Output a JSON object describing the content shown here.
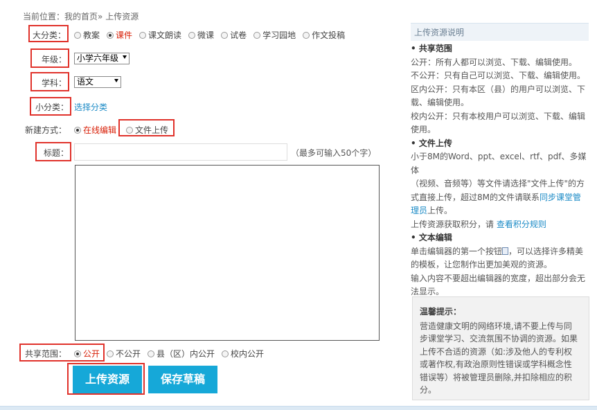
{
  "breadcrumb": {
    "prefix": "当前位置：",
    "home": "我的首页",
    "sep": "»",
    "current": "上传资源"
  },
  "category": {
    "label": "大分类：",
    "options": [
      {
        "label": "教案",
        "selected": false
      },
      {
        "label": "课件",
        "selected": true
      },
      {
        "label": "课文朗读",
        "selected": false
      },
      {
        "label": "微课",
        "selected": false
      },
      {
        "label": "试卷",
        "selected": false
      },
      {
        "label": "学习园地",
        "selected": false
      },
      {
        "label": "作文投稿",
        "selected": false
      }
    ]
  },
  "grade": {
    "label": "年级：",
    "value": "小学六年级"
  },
  "subject": {
    "label": "学科：",
    "value": "语文"
  },
  "subcategory": {
    "label": "小分类：",
    "link": "选择分类"
  },
  "create_mode": {
    "label": "新建方式：",
    "options": [
      {
        "label": "在线编辑",
        "selected": true
      },
      {
        "label": "文件上传",
        "selected": false
      }
    ]
  },
  "title_field": {
    "label": "标题：",
    "value": "",
    "hint": "（最多可输入50个字）"
  },
  "share": {
    "label": "共享范围：",
    "options": [
      {
        "label": "公开",
        "selected": true
      },
      {
        "label": "不公开",
        "selected": false
      },
      {
        "label": "县（区）内公开",
        "selected": false
      },
      {
        "label": "校内公开",
        "selected": false
      }
    ]
  },
  "buttons": {
    "upload": "上传资源",
    "save_draft": "保存草稿"
  },
  "sidebar": {
    "title": "上传资源说明",
    "share_heading": "• 共享范围",
    "share_lines": [
      "公开：所有人都可以浏览、下载、编辑使用。",
      "不公开：只有自己可以浏览、下载、编辑使用。",
      "区内公开：只有本区（县）的用户可以浏览、下",
      "载、编辑使用。",
      "校内公开：只有本校用户可以浏览、下载、编辑",
      "使用。"
    ],
    "upload_heading": "• 文件上传",
    "upload_lines": [
      "小于8M的Word、ppt、excel、rtf、pdf、多媒体",
      "（视频、音频等）等文件请选择\"文件上传\"的方",
      "式直接上传，超过8M的文件请联系"
    ],
    "upload_link": "同步课堂管",
    "upload_link2": "理员",
    "upload_tail": "上传。",
    "points_prefix": "上传资源获取积分，请 ",
    "points_link": "查看积分规则",
    "text_heading": "• 文本编辑",
    "text_line1a": "单击编辑器的第一个按钮",
    "text_line1b": "，可以选择许多精美",
    "text_lines": [
      "的模板，让您制作出更加美观的资源。",
      "输入内容不要超出编辑器的宽度，超出部分会无",
      "法显示。"
    ]
  },
  "tip": {
    "title": "温馨提示：",
    "lines": [
      "营造健康文明的网络环境,请不要上传与同",
      "步课堂学习、交流氛围不协调的资源。如果",
      "上传不合适的资源（如:涉及他人的专利权",
      "或著作权,有政治原则性错误或学科概念性",
      "错误等）将被管理员删除,并扣除相应的积",
      "分。"
    ]
  }
}
